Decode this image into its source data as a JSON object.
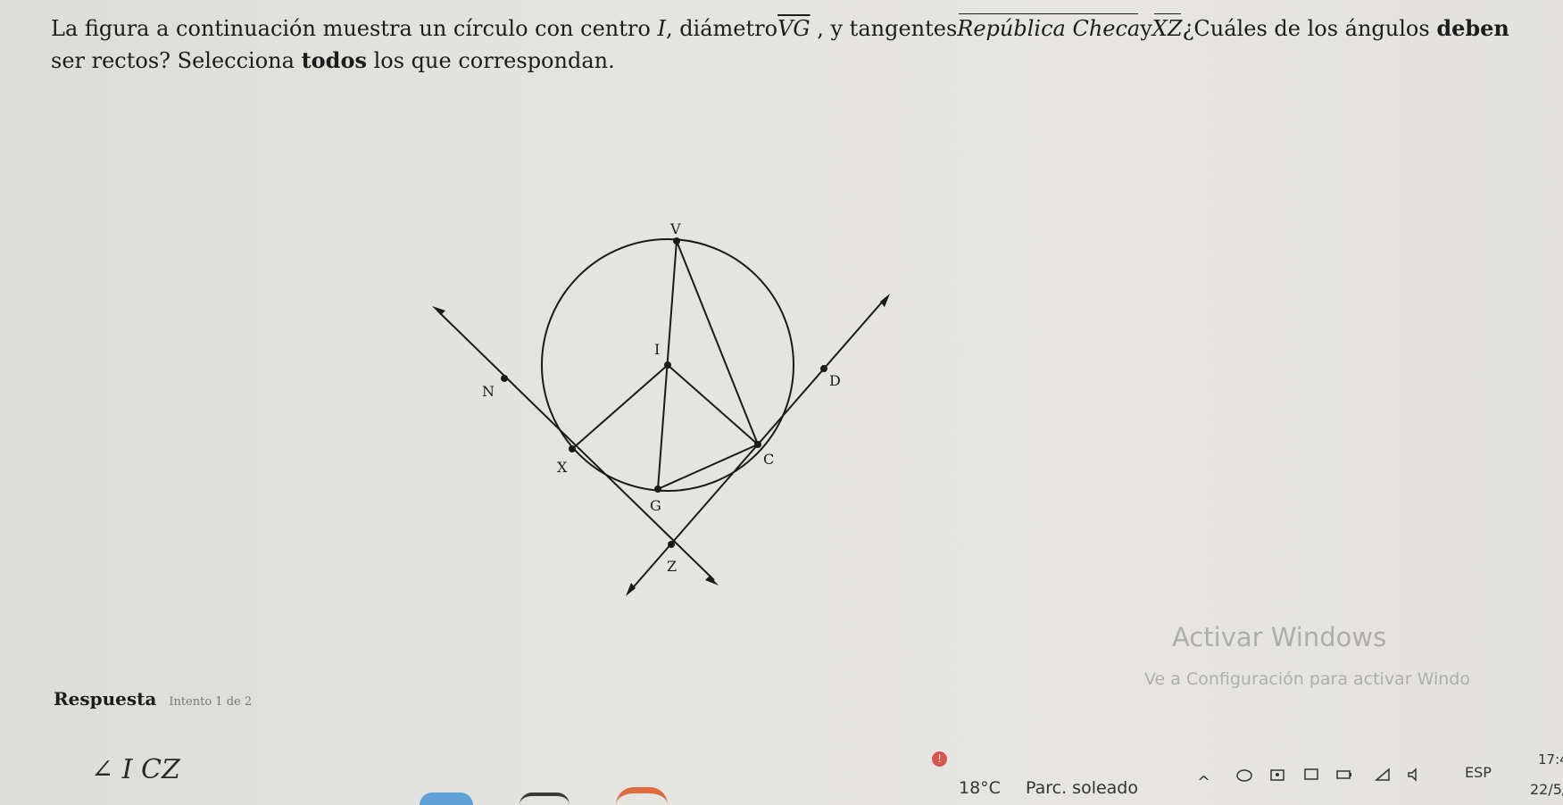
{
  "question": {
    "part1": "La figura a continuación muestra un círculo con centro",
    "center": "I",
    "part2": ", diámetro",
    "diameter": "VG",
    "part3": " , y tangentes",
    "tangent1": "República Checa",
    "part4": "y",
    "tangent2": "XZ",
    "part5": "¿Cuáles de los ángulos ",
    "emphasis1": "deben",
    "part6": " ser rectos? Selecciona ",
    "emphasis2": "todos",
    "part7": " los que correspondan."
  },
  "figure": {
    "labels": {
      "V": "V",
      "I": "I",
      "N": "N",
      "D": "D",
      "X": "X",
      "C": "C",
      "G": "G",
      "Z": "Z"
    }
  },
  "answer": {
    "heading": "Respuesta",
    "attempt": "Intento 1 de 2",
    "option1": "∠ I CZ"
  },
  "watermark": {
    "title": "Activar Windows",
    "subtitle": "Ve a Configuración para activar Windo"
  },
  "taskbar": {
    "weather_temp": "18°C",
    "weather_desc": "Parc. soleado",
    "language": "ESP",
    "time": "17:4",
    "date": "22/5/"
  }
}
